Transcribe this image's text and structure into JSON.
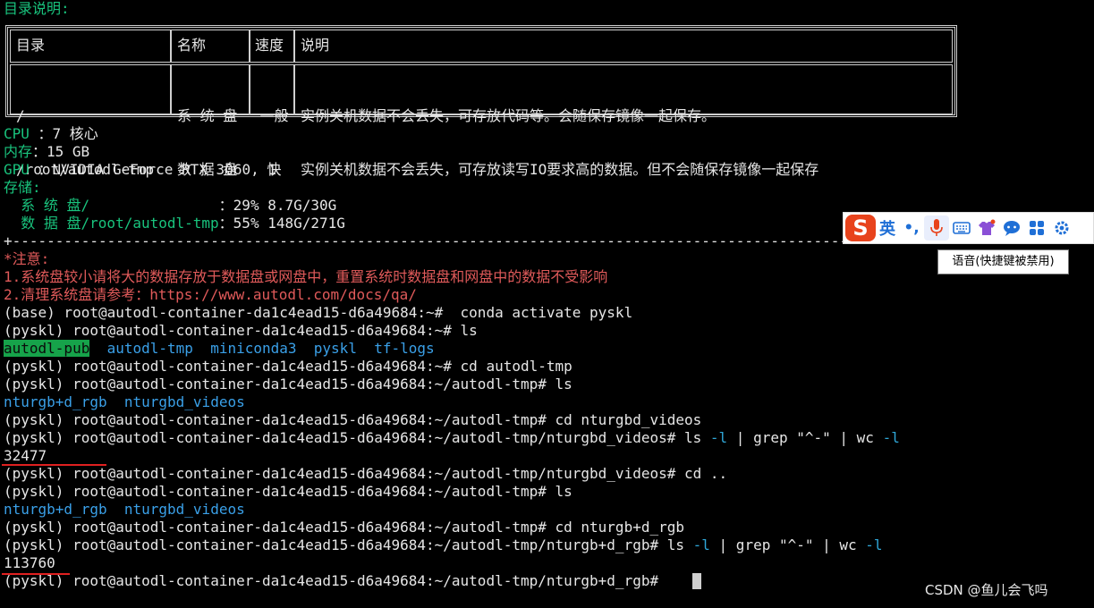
{
  "header": {
    "title": "目录说明:"
  },
  "table": {
    "headers": [
      "目录",
      "名称",
      "速度",
      "说明"
    ],
    "rows": [
      {
        "dir": "/",
        "name": "系 统 盘",
        "speed": "一般",
        "desc": "实例关机数据不会丢失，可存放代码等。会随保存镜像一起保存。"
      },
      {
        "dir": "/root/autodl-tmp",
        "name": "数 据 盘",
        "speed": "快",
        "desc": "实例关机数据不会丢失，可存放读写IO要求高的数据。但不会随保存镜像一起保存"
      }
    ]
  },
  "system": {
    "cpu_label": "CPU ",
    "cpu_value": "：7 核心",
    "mem_label": "内存",
    "mem_value": "：15 GB",
    "gpu_label": "GPU ",
    "gpu_value": "：NVIDIA GeForce RTX 3060, 1",
    "storage_label": "存储:",
    "disk1_label": "  系 统 盘/               ",
    "disk1_value": "：29% 8.7G/30G",
    "disk2_label": "  数 据 盘/root/autodl-tmp",
    "disk2_value": "：55% 148G/271G"
  },
  "separator": "+------------------------------------------------------------------------------------------------------------------------+",
  "notice": {
    "title": "*注意:",
    "line1": "1.系统盘较小请将大的数据存放于数据盘或网盘中，重置系统时数据盘和网盘中的数据不受影响",
    "line2": "2.清理系统盘请参考：https://www.autodl.com/docs/qa/"
  },
  "prompts": {
    "base_home": "(base) root@autodl-container-da1c4ead15-d6a49684:~# ",
    "home": "(pyskl) root@autodl-container-da1c4ead15-d6a49684:~# ",
    "tmp": "(pyskl) root@autodl-container-da1c4ead15-d6a49684:~/autodl-tmp# ",
    "videos": "(pyskl) root@autodl-container-da1c4ead15-d6a49684:~/autodl-tmp/nturgbd_videos# ",
    "rgb": "(pyskl) root@autodl-container-da1c4ead15-d6a49684:~/autodl-tmp/nturgb+d_rgb# "
  },
  "commands": {
    "conda": " conda activate pyskl",
    "ls": "ls",
    "cd_tmp": "cd autodl-tmp",
    "cd_videos": "cd nturgbd_videos",
    "cd_up": "cd ..",
    "cd_rgb": "cd nturgb+d_rgb",
    "ls_word": "ls ",
    "flag_l": "-l",
    "pipe_grep": " | grep \"^-\" | wc ",
    "flag_l2": "-l"
  },
  "dirs_home": [
    "autodl-pub",
    "autodl-tmp",
    "miniconda3",
    "pyskl",
    "tf-logs"
  ],
  "dirs_tmp": [
    "nturgb+d_rgb",
    "nturgbd_videos"
  ],
  "counts": {
    "videos": "32477",
    "rgb": "113760"
  },
  "ime": {
    "logo": "S",
    "lang": "英",
    "punct": "•,",
    "tooltip": "语音(快捷键被禁用)"
  },
  "watermark": "CSDN @鱼儿会飞吗",
  "colors": {
    "label_green": "#19c37d",
    "notice_red": "#e05a5a",
    "dir_blue": "#3aa0e8",
    "highlight_green": "#16a34a",
    "underline_red": "#e02020",
    "ime_logo": "#e8431c"
  }
}
